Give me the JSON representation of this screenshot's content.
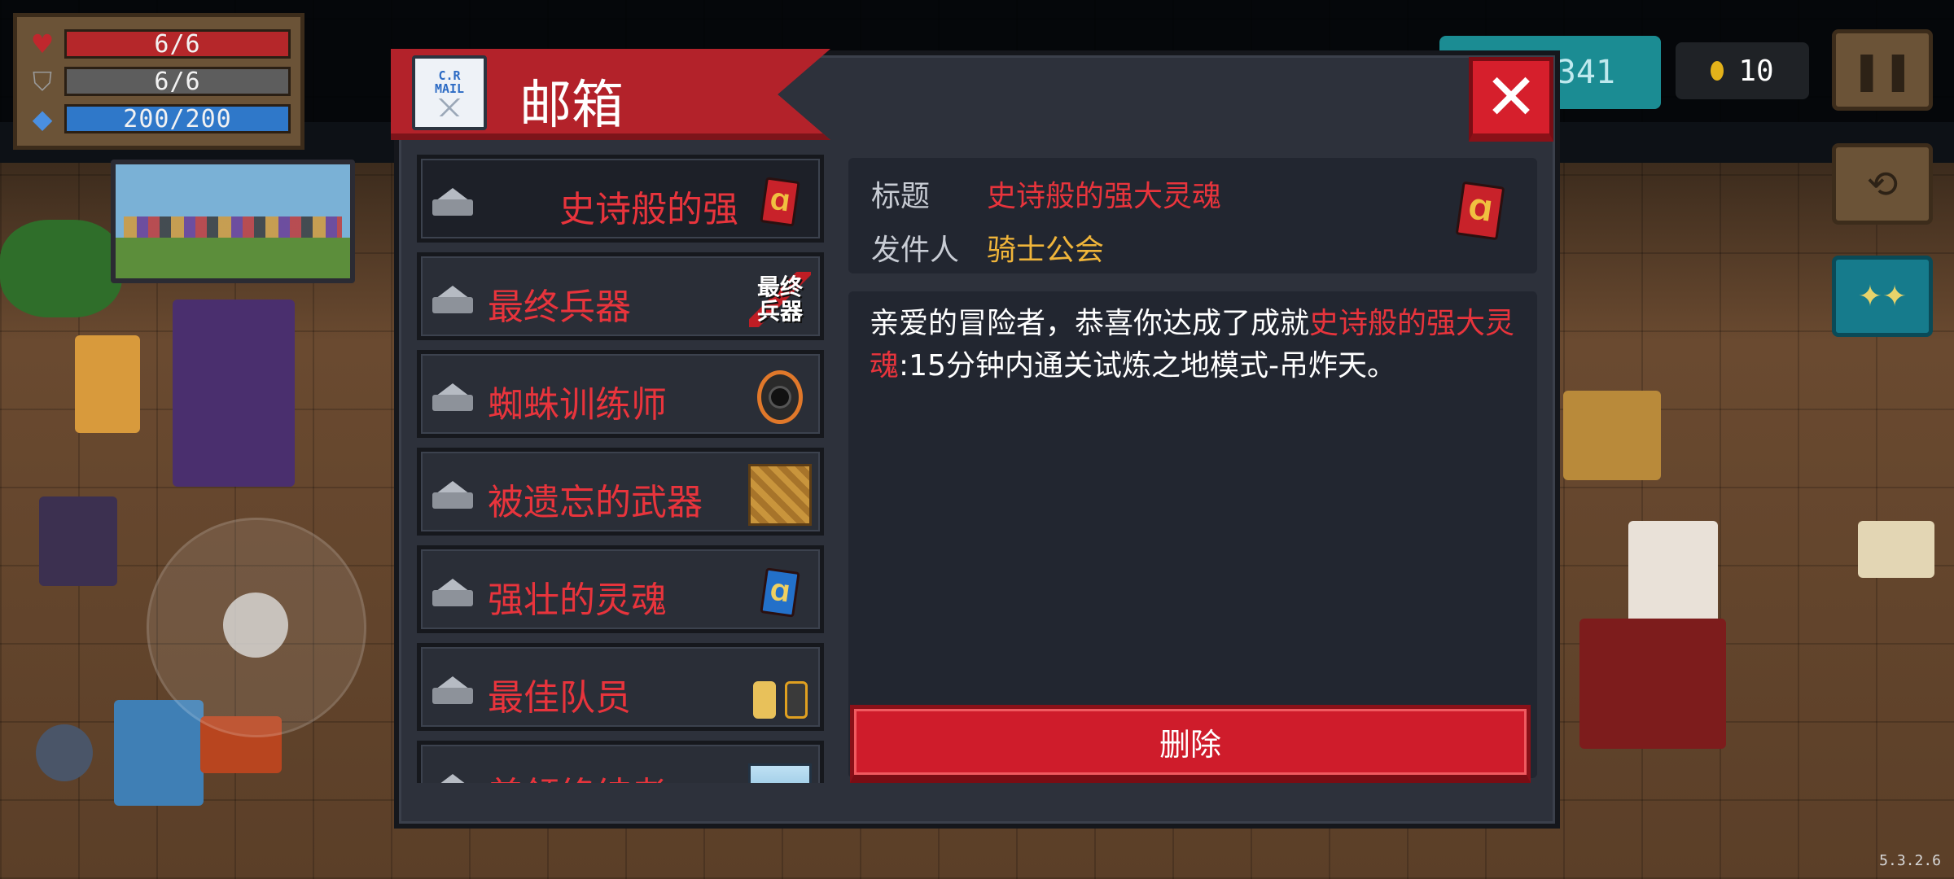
{
  "hud": {
    "hp": "6/6",
    "armor": "6/6",
    "energy": "200/200",
    "gems": "341",
    "coins": "10"
  },
  "mailbox": {
    "title": "邮箱",
    "mail_icon_stamp_line1": "C.R",
    "mail_icon_stamp_line2": "MAIL",
    "close_label": "✕",
    "items": [
      {
        "label": "史诗般的强",
        "icon": "red-card-icon"
      },
      {
        "label": "最终兵器",
        "icon": "final-weapon-icon",
        "icon_text": "最终兵器"
      },
      {
        "label": "蜘蛛训练师",
        "icon": "spider-trainer-icon"
      },
      {
        "label": "被遗忘的武器",
        "icon": "scroll-icon"
      },
      {
        "label": "强壮的灵魂",
        "icon": "blue-card-icon"
      },
      {
        "label": "最佳队员",
        "icon": "team-icon"
      },
      {
        "label": "美领终结者",
        "icon": "sky-icon"
      }
    ],
    "detail": {
      "title_label": "标题",
      "title_value": "史诗般的强大灵魂",
      "sender_label": "发件人",
      "sender_value": "骑士公会",
      "message_prefix": "亲爱的冒险者，恭喜你达成了成就",
      "message_highlight": "史诗般的强大灵魂",
      "message_suffix": ":15分钟内通关试炼之地模式-吊炸天。",
      "delete_label": "删除"
    }
  },
  "version": "5.3.2.6",
  "colors": {
    "accent_red": "#e8343c",
    "sender_gold": "#f0b53a",
    "banner_red": "#b3222a",
    "panel": "#2d313b"
  }
}
